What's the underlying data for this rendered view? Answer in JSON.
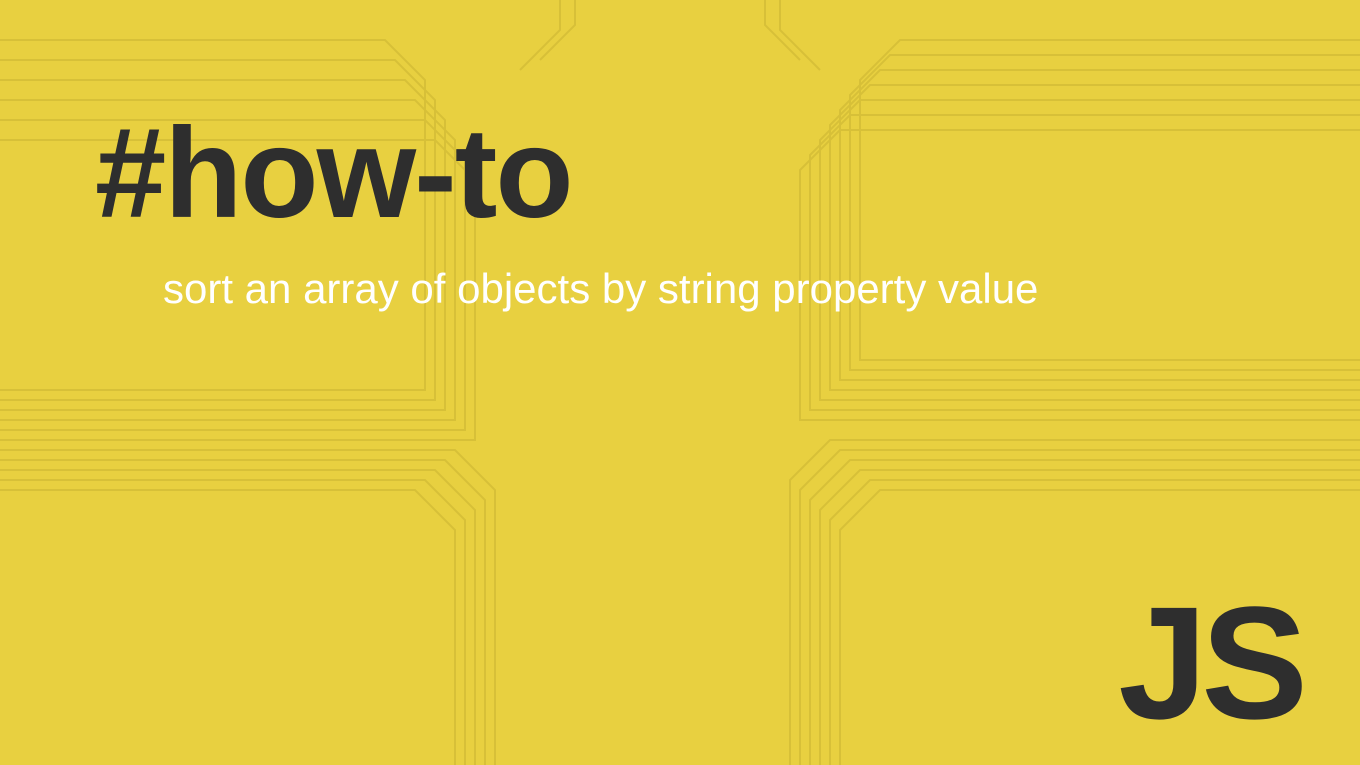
{
  "heading": "#how-to",
  "subtitle": "sort an array of objects by string property value",
  "badge": "JS",
  "colors": {
    "background": "#e8d040",
    "text_dark": "#2e2e2e",
    "text_light": "#ffffff",
    "circuit": "#d8c13a"
  }
}
